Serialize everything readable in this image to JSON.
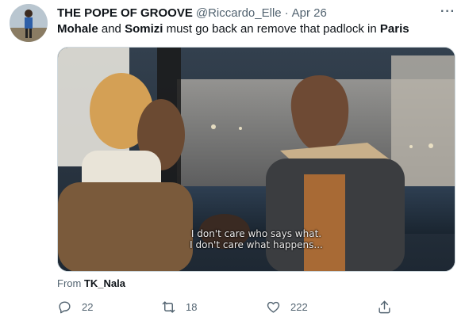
{
  "tweet": {
    "display_name": "THE POPE OF GROOVE",
    "handle": "@Riccardo_Elle",
    "separator": "·",
    "date": "Apr 26",
    "more_label": "···",
    "text_parts": [
      "Mohale",
      " and ",
      "Somizi",
      " must go back an remove that padlock in ",
      "Paris"
    ]
  },
  "media": {
    "subtitle_line1": "I don't care who says what.",
    "subtitle_line2": "I don't care what happens..."
  },
  "attribution": {
    "prefix": "From ",
    "source": "TK_Nala"
  },
  "actions": {
    "replies": "22",
    "retweets": "18",
    "likes": "222"
  },
  "icons": [
    "avatar",
    "more-icon",
    "reply-icon",
    "retweet-icon",
    "like-icon",
    "share-icon"
  ]
}
